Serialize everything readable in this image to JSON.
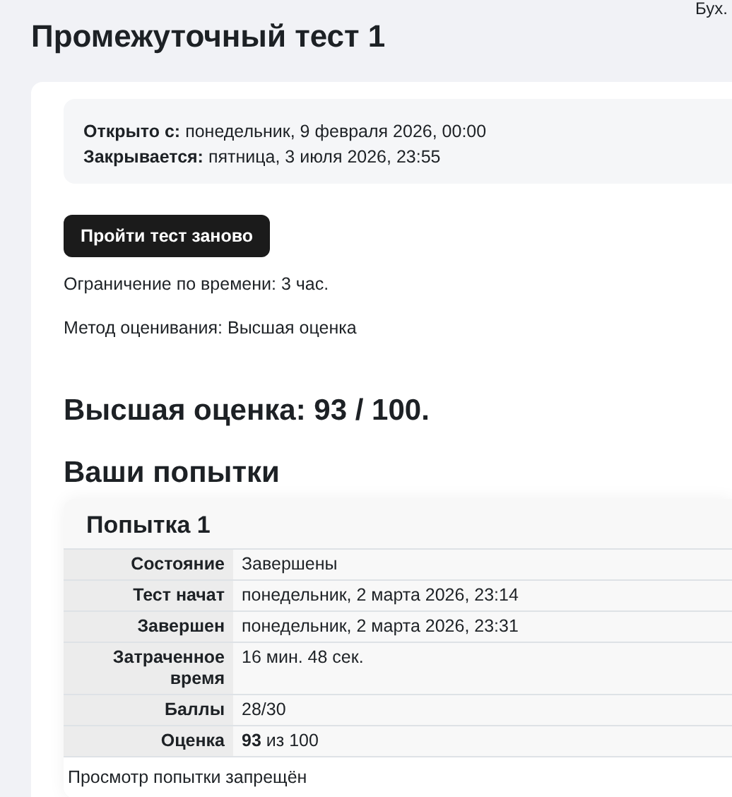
{
  "header": {
    "user_text": "Бух."
  },
  "title": "Промежуточный тест 1",
  "availability": [
    {
      "label": "Открыто с:",
      "value": "понедельник, 9 февраля 2026, 00:00"
    },
    {
      "label": "Закрывается:",
      "value": "пятница, 3 июля 2026, 23:55"
    }
  ],
  "retake_button": "Пройти тест заново",
  "details": [
    "Ограничение по времени: 3 час.",
    "Метод оценивания: Высшая оценка"
  ],
  "best_grade": "Высшая оценка: 93 / 100.",
  "attempts_heading": "Ваши попытки",
  "attempts": [
    {
      "title": "Попытка 1",
      "rows": [
        {
          "label": "Состояние",
          "value": "Завершены"
        },
        {
          "label": "Тест начат",
          "value": "понедельник, 2 марта 2026, 23:14"
        },
        {
          "label": "Завершен",
          "value": "понедельник, 2 марта 2026, 23:31"
        },
        {
          "label": "Затраченное время",
          "value": "16 мин. 48 сек."
        },
        {
          "label": "Баллы",
          "value": "28/30"
        },
        {
          "label": "Оценка",
          "value": "**93** из 100"
        }
      ],
      "review_note": "Просмотр попытки запрещён"
    }
  ]
}
